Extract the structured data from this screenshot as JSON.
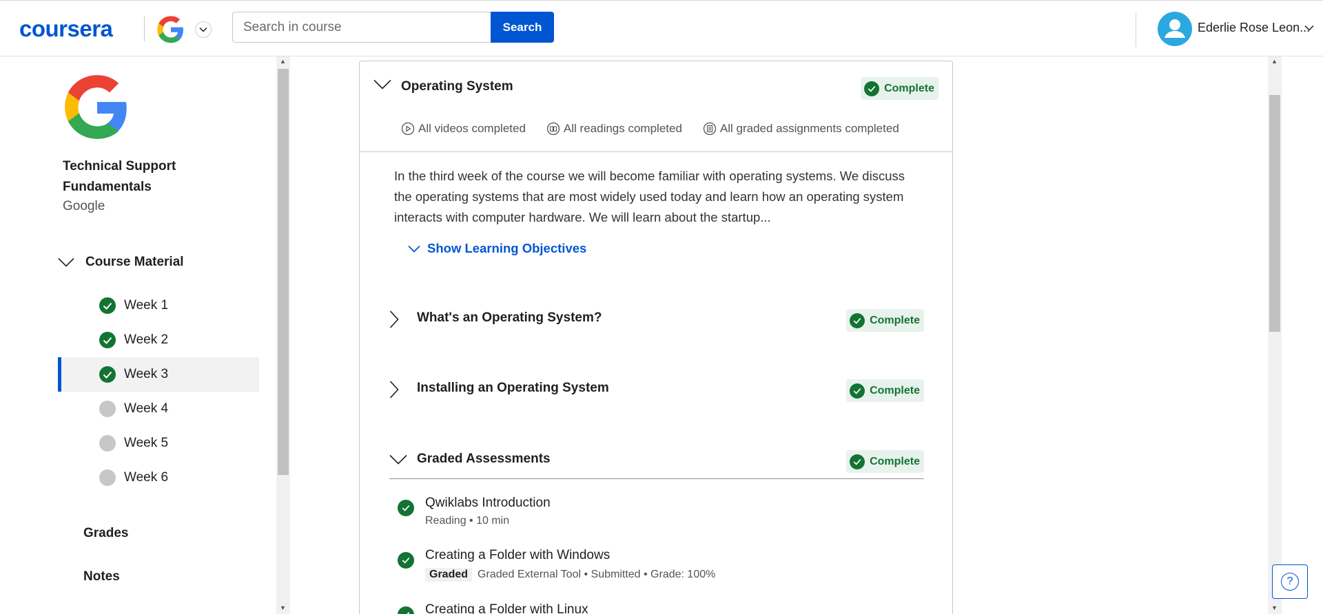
{
  "header": {
    "logo_text": "coursera",
    "search_placeholder": "Search in course",
    "search_button": "Search",
    "user_name": "Ederlie Rose Leon..."
  },
  "sidebar": {
    "course_title": "Technical Support Fundamentals",
    "partner": "Google",
    "section_label": "Course Material",
    "weeks": [
      {
        "label": "Week 1",
        "status": "complete"
      },
      {
        "label": "Week 2",
        "status": "complete"
      },
      {
        "label": "Week 3",
        "status": "complete",
        "active": true
      },
      {
        "label": "Week 4",
        "status": "incomplete"
      },
      {
        "label": "Week 5",
        "status": "incomplete"
      },
      {
        "label": "Week 6",
        "status": "incomplete"
      }
    ],
    "links": [
      "Grades",
      "Notes"
    ]
  },
  "module": {
    "title": "Operating System",
    "status": "Complete",
    "stats": {
      "videos": "All videos completed",
      "readings": "All readings completed",
      "assignments": "All graded assignments completed"
    },
    "description": "In the third week of the course we will become familiar with operating systems. We discuss the operating systems that are most widely used today and learn how an operating system interacts with computer hardware. We will learn about the startup...",
    "objectives_link": "Show Learning Objectives",
    "lessons": [
      {
        "title": "What's an Operating System?",
        "status": "Complete"
      },
      {
        "title": "Installing an Operating System",
        "status": "Complete"
      },
      {
        "title": "Graded Assessments",
        "status": "Complete"
      }
    ],
    "items": [
      {
        "name": "Qwiklabs Introduction",
        "meta": "Reading • 10 min"
      },
      {
        "name": "Creating a Folder with Windows",
        "tag": "Graded",
        "meta": "Graded External Tool • Submitted • Grade: 100%"
      },
      {
        "name": "Creating a Folder with Linux"
      }
    ]
  },
  "colors": {
    "brand": "#0056d2",
    "complete": "#137333",
    "complete_bg": "#e8f2ec"
  },
  "help_label": "?"
}
